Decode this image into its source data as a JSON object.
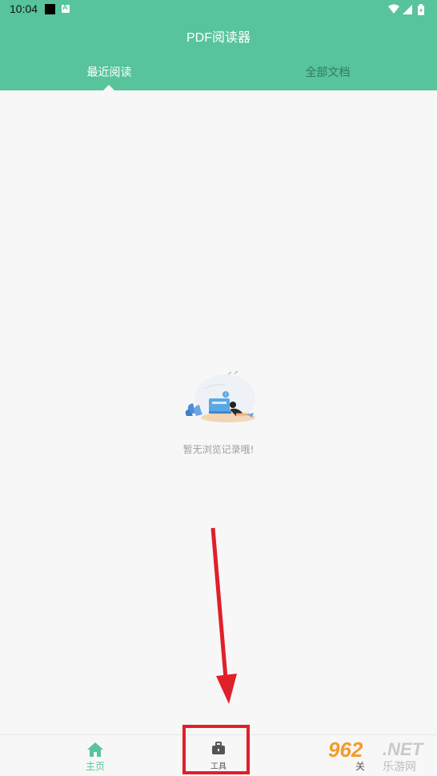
{
  "status_bar": {
    "time": "10:04",
    "icons": [
      "notification-square-icon",
      "text-a-icon",
      "wifi-icon",
      "signal-icon",
      "battery-icon"
    ]
  },
  "header": {
    "title": "PDF阅读器",
    "tabs": [
      {
        "label": "最近阅读",
        "active": true
      },
      {
        "label": "全部文档",
        "active": false
      }
    ]
  },
  "empty_state": {
    "illustration": "empty-reading-illustration",
    "message": "暂无浏览记录哦!"
  },
  "bottom_nav": {
    "items": [
      {
        "label": "主页",
        "icon": "home-icon",
        "active": true
      },
      {
        "label": "工具",
        "icon": "toolbox-icon",
        "active": false
      },
      {
        "label": "关",
        "icon": "",
        "active": false
      }
    ]
  },
  "annotation": {
    "arrow_color": "#e0202a",
    "highlight": "工具"
  },
  "watermark": {
    "number": "962",
    "suffix": ".NET",
    "text": "乐游网"
  },
  "colors": {
    "accent": "#57c49b",
    "background": "#f7f7f7",
    "annotation_red": "#e0202a"
  }
}
